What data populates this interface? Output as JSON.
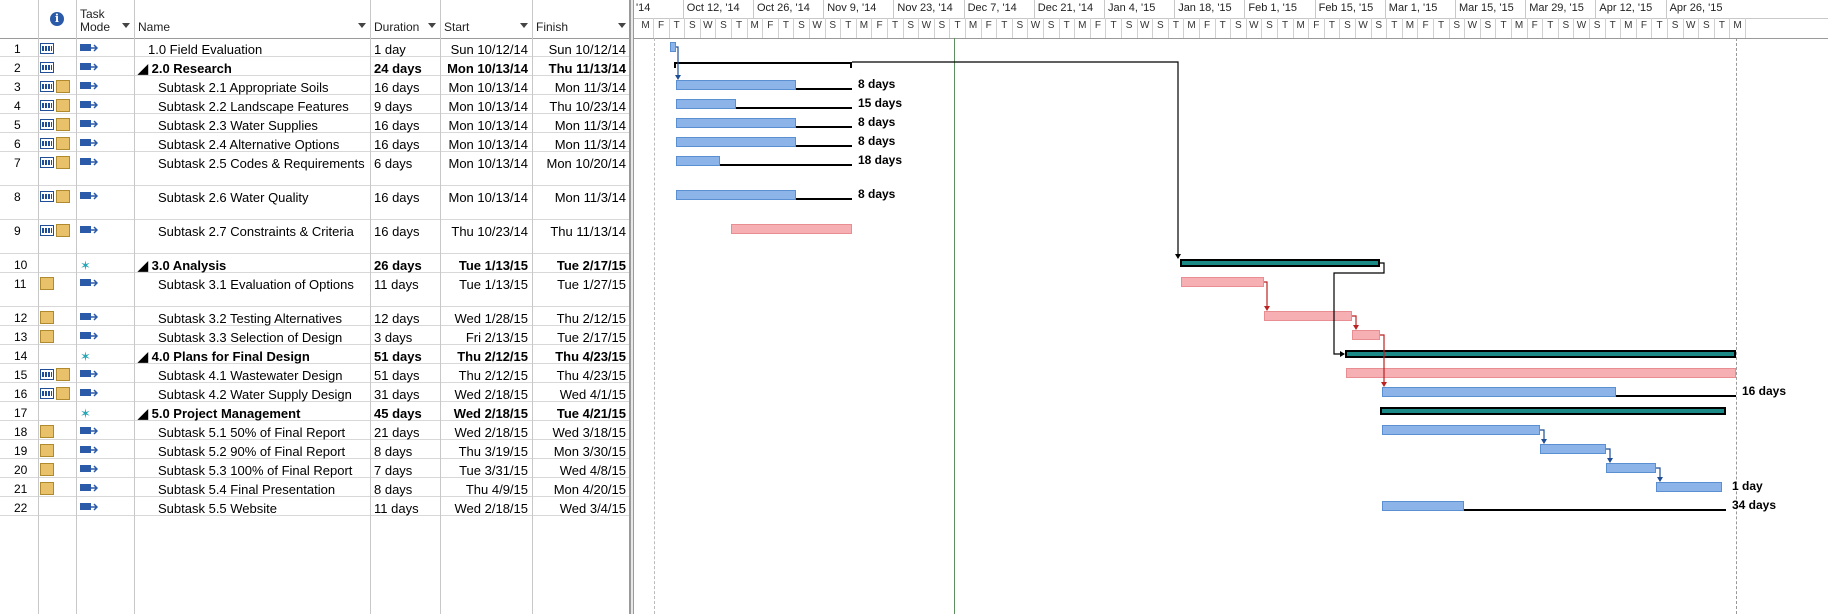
{
  "grid": {
    "headers": {
      "info_icon": "info-icon",
      "task_mode": "Task Mode",
      "name": "Name",
      "duration": "Duration",
      "start": "Start",
      "finish": "Finish"
    },
    "rows": [
      {
        "id": "1",
        "name": "1.0 Field Evaluation",
        "duration": "1 day",
        "start": "Sun 10/12/14",
        "finish": "Sun 10/12/14",
        "bold": false,
        "summary": false,
        "indent": 1
      },
      {
        "id": "2",
        "name": "◢ 2.0 Research",
        "duration": "24 days",
        "start": "Mon 10/13/14",
        "finish": "Thu 11/13/14",
        "bold": true,
        "summary": true,
        "indent": 0
      },
      {
        "id": "3",
        "name": "Subtask 2.1 Appropriate Soils",
        "duration": "16 days",
        "start": "Mon 10/13/14",
        "finish": "Mon 11/3/14",
        "bold": false,
        "summary": false,
        "indent": 2
      },
      {
        "id": "4",
        "name": "Subtask 2.2 Landscape Features",
        "duration": "9 days",
        "start": "Mon 10/13/14",
        "finish": "Thu 10/23/14",
        "bold": false,
        "summary": false,
        "indent": 2
      },
      {
        "id": "5",
        "name": "Subtask 2.3 Water Supplies",
        "duration": "16 days",
        "start": "Mon 10/13/14",
        "finish": "Mon 11/3/14",
        "bold": false,
        "summary": false,
        "indent": 2
      },
      {
        "id": "6",
        "name": "Subtask 2.4 Alternative Options",
        "duration": "16 days",
        "start": "Mon 10/13/14",
        "finish": "Mon 11/3/14",
        "bold": false,
        "summary": false,
        "indent": 2
      },
      {
        "id": "7",
        "name": "Subtask 2.5 Codes & Requirements",
        "duration": "6 days",
        "start": "Mon 10/13/14",
        "finish": "Mon 10/20/14",
        "bold": false,
        "summary": false,
        "indent": 2
      },
      {
        "id": "8",
        "name": "Subtask 2.6 Water Quality",
        "duration": "16 days",
        "start": "Mon 10/13/14",
        "finish": "Mon 11/3/14",
        "bold": false,
        "summary": false,
        "indent": 2
      },
      {
        "id": "9",
        "name": "Subtask 2.7 Constraints & Criteria",
        "duration": "16 days",
        "start": "Thu 10/23/14",
        "finish": "Thu 11/13/14",
        "bold": false,
        "summary": false,
        "indent": 2
      },
      {
        "id": "10",
        "name": "◢ 3.0 Analysis",
        "duration": "26 days",
        "start": "Tue 1/13/15",
        "finish": "Tue 2/17/15",
        "bold": true,
        "summary": true,
        "indent": 0
      },
      {
        "id": "11",
        "name": "Subtask 3.1 Evaluation of Options",
        "duration": "11 days",
        "start": "Tue 1/13/15",
        "finish": "Tue 1/27/15",
        "bold": false,
        "summary": false,
        "indent": 2
      },
      {
        "id": "12",
        "name": "Subtask 3.2 Testing Alternatives",
        "duration": "12 days",
        "start": "Wed 1/28/15",
        "finish": "Thu 2/12/15",
        "bold": false,
        "summary": false,
        "indent": 2
      },
      {
        "id": "13",
        "name": "Subtask 3.3 Selection of Design",
        "duration": "3 days",
        "start": "Fri 2/13/15",
        "finish": "Tue 2/17/15",
        "bold": false,
        "summary": false,
        "indent": 2
      },
      {
        "id": "14",
        "name": "◢ 4.0 Plans for Final Design",
        "duration": "51 days",
        "start": "Thu 2/12/15",
        "finish": "Thu 4/23/15",
        "bold": true,
        "summary": true,
        "indent": 0
      },
      {
        "id": "15",
        "name": "Subtask 4.1 Wastewater Design",
        "duration": "51 days",
        "start": "Thu 2/12/15",
        "finish": "Thu 4/23/15",
        "bold": false,
        "summary": false,
        "indent": 2
      },
      {
        "id": "16",
        "name": "Subtask 4.2 Water Supply Design",
        "duration": "31 days",
        "start": "Wed 2/18/15",
        "finish": "Wed 4/1/15",
        "bold": false,
        "summary": false,
        "indent": 2
      },
      {
        "id": "17",
        "name": "◢ 5.0 Project Management",
        "duration": "45 days",
        "start": "Wed 2/18/15",
        "finish": "Tue 4/21/15",
        "bold": true,
        "summary": true,
        "indent": 0
      },
      {
        "id": "18",
        "name": "Subtask 5.1 50% of Final Report",
        "duration": "21 days",
        "start": "Wed 2/18/15",
        "finish": "Wed 3/18/15",
        "bold": false,
        "summary": false,
        "indent": 2
      },
      {
        "id": "19",
        "name": "Subtask 5.2 90% of Final Report",
        "duration": "8 days",
        "start": "Thu 3/19/15",
        "finish": "Mon 3/30/15",
        "bold": false,
        "summary": false,
        "indent": 2
      },
      {
        "id": "20",
        "name": "Subtask 5.3 100% of Final Report",
        "duration": "7 days",
        "start": "Tue 3/31/15",
        "finish": "Wed 4/8/15",
        "bold": false,
        "summary": false,
        "indent": 2
      },
      {
        "id": "21",
        "name": "Subtask 5.4 Final Presentation",
        "duration": "8 days",
        "start": "Thu 4/9/15",
        "finish": "Mon 4/20/15",
        "bold": false,
        "summary": false,
        "indent": 2
      },
      {
        "id": "22",
        "name": "Subtask 5.5 Website",
        "duration": "11 days",
        "start": "Wed 2/18/15",
        "finish": "Wed 3/4/15",
        "bold": false,
        "summary": false,
        "indent": 2
      }
    ]
  },
  "timescale": {
    "majors": [
      "'14",
      "Oct 12, '14",
      "Oct 26, '14",
      "Nov 9, '14",
      "Nov 23, '14",
      "Dec 7, '14",
      "Dec 21, '14",
      "Jan 4, '15",
      "Jan 18, '15",
      "Feb 1, '15",
      "Feb 15, '15",
      "Mar 1, '15",
      "Mar 15, '15",
      "Mar 29, '15",
      "Apr 12, '15",
      "Apr 26, '15"
    ],
    "minors": [
      "M",
      "F",
      "T",
      "S",
      "W",
      "S",
      "T",
      "M",
      "F",
      "T",
      "S",
      "W",
      "S",
      "T",
      "M",
      "F",
      "T",
      "S",
      "W",
      "S",
      "T",
      "M",
      "F",
      "T",
      "S",
      "W",
      "S",
      "T",
      "M",
      "F",
      "T",
      "S",
      "W",
      "S",
      "T",
      "M",
      "F",
      "T",
      "S",
      "W",
      "S",
      "T",
      "M",
      "F",
      "T",
      "S",
      "W",
      "S",
      "T",
      "M",
      "F",
      "T",
      "S",
      "W",
      "S",
      "T",
      "M",
      "F",
      "T",
      "S",
      "W",
      "S",
      "T",
      "M",
      "F",
      "T",
      "S",
      "W",
      "S",
      "T",
      "M"
    ]
  },
  "bar_labels": {
    "r3": "8 days",
    "r4": "15 days",
    "r5": "8 days",
    "r6": "8 days",
    "r7": "18 days",
    "r8": "8 days",
    "r16": "16 days",
    "r21": "1 day",
    "r22": "34 days"
  },
  "colors": {
    "auto_bar": "#8db4e8",
    "manual_bar": "#f6b0b4",
    "summary_fill": "#1b8a86"
  }
}
